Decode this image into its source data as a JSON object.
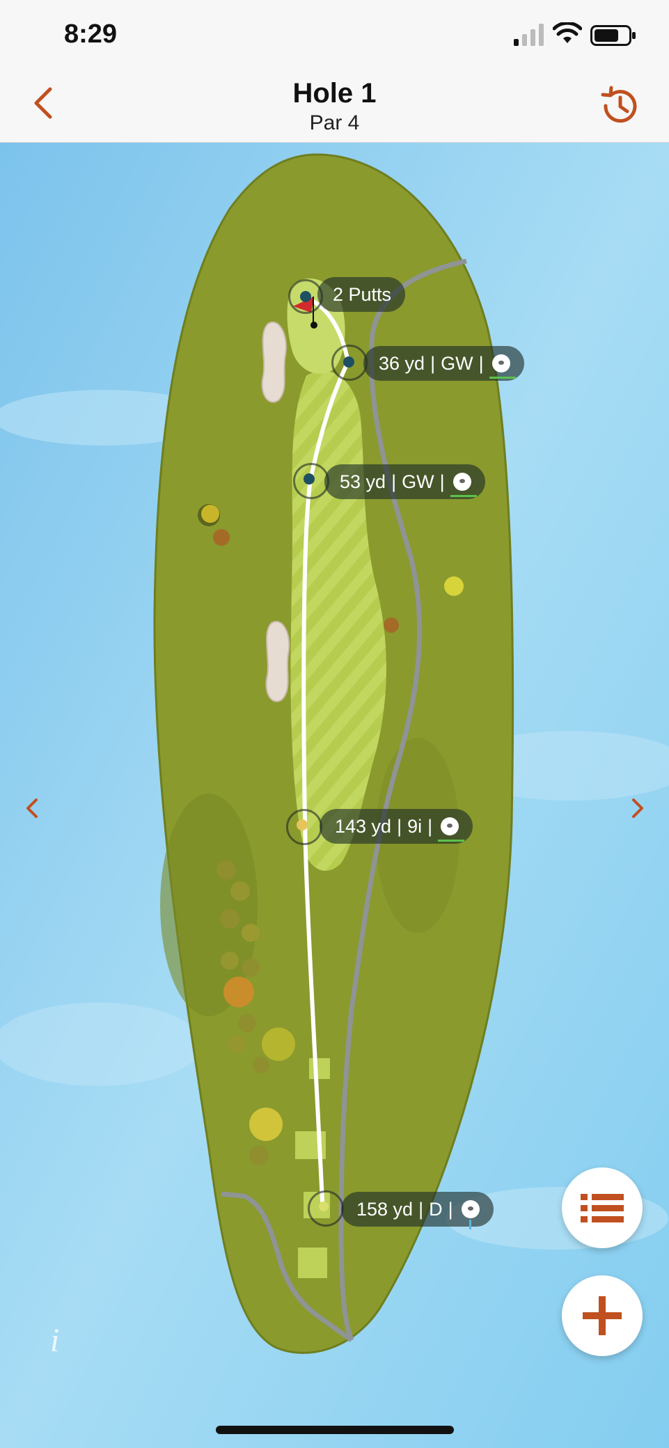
{
  "status_bar": {
    "time": "8:29"
  },
  "header": {
    "title": "Hole 1",
    "subtitle": "Par 4"
  },
  "shots": [
    {
      "label": "2 Putts",
      "type": "putts"
    },
    {
      "distance": "36 yd",
      "club": "GW",
      "lie": "fairway"
    },
    {
      "distance": "53 yd",
      "club": "GW",
      "lie": "fairway"
    },
    {
      "distance": "143 yd",
      "club": "9i",
      "lie": "fairway"
    },
    {
      "distance": "158 yd",
      "club": "D",
      "lie": "tee"
    }
  ],
  "colors": {
    "accent": "#c0501f",
    "sky": "#8fd0f0",
    "rough": "#8a9a2d",
    "fairway": "#b9cf52",
    "shot_path": "#ffffff",
    "approach_marker": "#1e4f63",
    "tee_marker": "#e5c45a"
  },
  "icons": {
    "back": "chevron-left-icon",
    "history": "history-icon",
    "list": "list-icon",
    "add": "plus-icon",
    "prev_hole": "chevron-left-icon",
    "next_hole": "chevron-right-icon",
    "info": "info-icon"
  },
  "info_label": "i"
}
